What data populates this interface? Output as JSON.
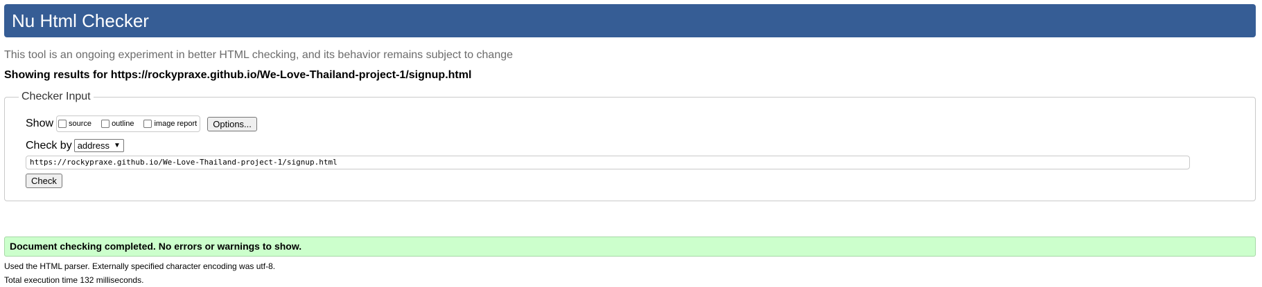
{
  "header": {
    "title": "Nu Html Checker"
  },
  "intro": "This tool is an ongoing experiment in better HTML checking, and its behavior remains subject to change",
  "results_heading": "Showing results for https://rockypraxe.github.io/We-Love-Thailand-project-1/signup.html",
  "checker": {
    "legend": "Checker Input",
    "show_label": "Show",
    "options": [
      "source",
      "outline",
      "image report"
    ],
    "options_button": "Options...",
    "check_by_label": "Check by",
    "check_by_value": "address",
    "url_value": "https://rockypraxe.github.io/We-Love-Thailand-project-1/signup.html",
    "check_button": "Check"
  },
  "status_message": "Document checking completed. No errors or warnings to show.",
  "meta": {
    "parser_info": "Used the HTML parser. Externally specified character encoding was utf-8.",
    "execution_time": "Total execution time 132 milliseconds."
  },
  "colors": {
    "header_bg": "#365d95",
    "success_bg": "#ccffcc"
  }
}
